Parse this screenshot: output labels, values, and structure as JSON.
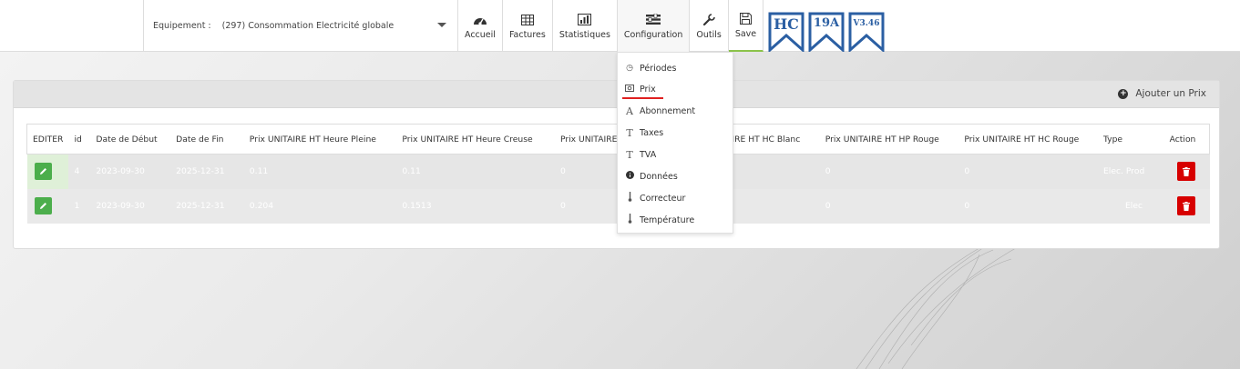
{
  "header": {
    "equipment_label": "Equipement :",
    "equipment_value": "(297) Consommation Electricité globale"
  },
  "nav": [
    {
      "label": "Accueil",
      "icon": "dashboard-icon"
    },
    {
      "label": "Factures",
      "icon": "table-icon"
    },
    {
      "label": "Statistiques",
      "icon": "bar-chart-icon"
    },
    {
      "label": "Configuration",
      "icon": "sliders-icon"
    },
    {
      "label": "Outils",
      "icon": "wrench-icon"
    },
    {
      "label": "Save",
      "icon": "floppy-icon"
    }
  ],
  "badges": [
    "HC",
    "19A",
    "V3.46"
  ],
  "panel": {
    "add_label": "Ajouter un Prix"
  },
  "table": {
    "columns": [
      "EDITER",
      "id",
      "Date de Début",
      "Date de Fin",
      "Prix UNITAIRE HT Heure Pleine",
      "Prix UNITAIRE HT Heure Creuse",
      "Prix UNITAIRE",
      "",
      "AIRE HT HC Blanc",
      "Prix UNITAIRE HT HP Rouge",
      "Prix UNITAIRE HT HC Rouge",
      "Type",
      "Action"
    ],
    "rows": [
      {
        "id": "4",
        "start": "2023-09-30",
        "end": "2025-12-31",
        "hp": "0.11",
        "hc": "0.11",
        "p1": "0",
        "p2": "",
        "hc_blanc": "",
        "hp_rouge": "0",
        "hc_rouge": "0",
        "type": "Elec. Prod"
      },
      {
        "id": "1",
        "start": "2023-09-30",
        "end": "2025-12-31",
        "hp": "0.204",
        "hc": "0.1513",
        "p1": "0",
        "p2": "",
        "hc_blanc": "",
        "hp_rouge": "0",
        "hc_rouge": "0",
        "type": "Elec"
      }
    ]
  },
  "menu": [
    {
      "label": "Périodes",
      "icon": "clock-icon"
    },
    {
      "label": "Prix",
      "icon": "money-icon"
    },
    {
      "label": "Abonnement",
      "icon": "font-icon"
    },
    {
      "label": "Taxes",
      "icon": "text-height-icon"
    },
    {
      "label": "TVA",
      "icon": "text-size-icon"
    },
    {
      "label": "Données",
      "icon": "info-icon"
    },
    {
      "label": "Correcteur",
      "icon": "thermometer-icon"
    },
    {
      "label": "Température",
      "icon": "thermometer-icon"
    }
  ],
  "colors": {
    "accent_green": "#4cae4c",
    "delete_red": "#d70000",
    "badge_blue": "#2b5fa3",
    "active_underline": "#e02020"
  }
}
